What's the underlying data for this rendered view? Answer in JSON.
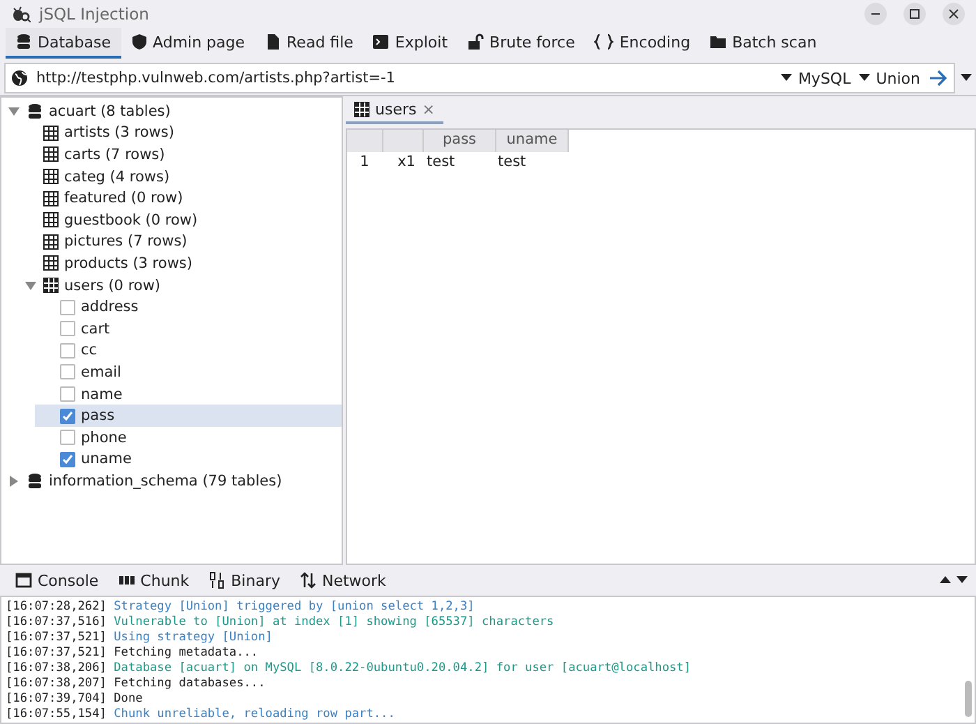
{
  "window": {
    "title": "jSQL Injection"
  },
  "tabs": [
    {
      "label": "Database",
      "selected": true
    },
    {
      "label": "Admin page",
      "selected": false
    },
    {
      "label": "Read file",
      "selected": false
    },
    {
      "label": "Exploit",
      "selected": false
    },
    {
      "label": "Brute force",
      "selected": false
    },
    {
      "label": "Encoding",
      "selected": false
    },
    {
      "label": "Batch scan",
      "selected": false
    }
  ],
  "address_bar": {
    "value": "http://testphp.vulnweb.com/artists.php?artist=-1",
    "database_menu": "MySQL",
    "strategy_menu": "Union"
  },
  "tree": [
    {
      "kind": "database",
      "label": "acuart (8 tables)",
      "expanded": true,
      "children": [
        {
          "kind": "table",
          "label": "artists (3 rows)"
        },
        {
          "kind": "table",
          "label": "carts (7 rows)"
        },
        {
          "kind": "table",
          "label": "categ (4 rows)"
        },
        {
          "kind": "table",
          "label": "featured (0 row)"
        },
        {
          "kind": "table",
          "label": "guestbook (0 row)"
        },
        {
          "kind": "table",
          "label": "pictures (7 rows)"
        },
        {
          "kind": "table",
          "label": "products (3 rows)"
        },
        {
          "kind": "table",
          "label": "users (0 row)",
          "expanded": true,
          "children": [
            {
              "kind": "column",
              "label": "address",
              "checked": false,
              "selected": false
            },
            {
              "kind": "column",
              "label": "cart",
              "checked": false,
              "selected": false
            },
            {
              "kind": "column",
              "label": "cc",
              "checked": false,
              "selected": false
            },
            {
              "kind": "column",
              "label": "email",
              "checked": false,
              "selected": false
            },
            {
              "kind": "column",
              "label": "name",
              "checked": false,
              "selected": false
            },
            {
              "kind": "column",
              "label": "pass",
              "checked": true,
              "selected": true
            },
            {
              "kind": "column",
              "label": "phone",
              "checked": false,
              "selected": false
            },
            {
              "kind": "column",
              "label": "uname",
              "checked": true,
              "selected": false
            }
          ]
        }
      ]
    },
    {
      "kind": "database",
      "label": "information_schema (79 tables)",
      "expanded": false
    }
  ],
  "result_tab": {
    "label": "users",
    "close": "×"
  },
  "table": {
    "columns": [
      "",
      "",
      "pass",
      "uname"
    ],
    "rows": [
      [
        "1",
        "x1",
        "test",
        "test"
      ]
    ]
  },
  "bottom_tabs": [
    {
      "label": "Console"
    },
    {
      "label": "Chunk"
    },
    {
      "label": "Binary"
    },
    {
      "label": "Network"
    }
  ],
  "console": [
    {
      "time": "[16:07:28,262]",
      "message": "Strategy [Union] triggered by [union select 1,2,3]",
      "kind": "info"
    },
    {
      "time": "[16:07:37,516]",
      "message": "Vulnerable to [Union] at index [1] showing [65537] characters",
      "kind": "success"
    },
    {
      "time": "[16:07:37,521]",
      "message": "Using strategy [Union]",
      "kind": "info"
    },
    {
      "time": "[16:07:37,521]",
      "message": "Fetching metadata...",
      "kind": "plain"
    },
    {
      "time": "[16:07:38,206]",
      "message": "Database [acuart] on MySQL [8.0.22-0ubuntu0.20.04.2] for user [acuart@localhost]",
      "kind": "success"
    },
    {
      "time": "[16:07:38,207]",
      "message": "Fetching databases...",
      "kind": "plain"
    },
    {
      "time": "[16:07:39,704]",
      "message": "Done",
      "kind": "plain"
    },
    {
      "time": "[16:07:55,154]",
      "message": "Chunk unreliable, reloading row part...",
      "kind": "info"
    }
  ]
}
